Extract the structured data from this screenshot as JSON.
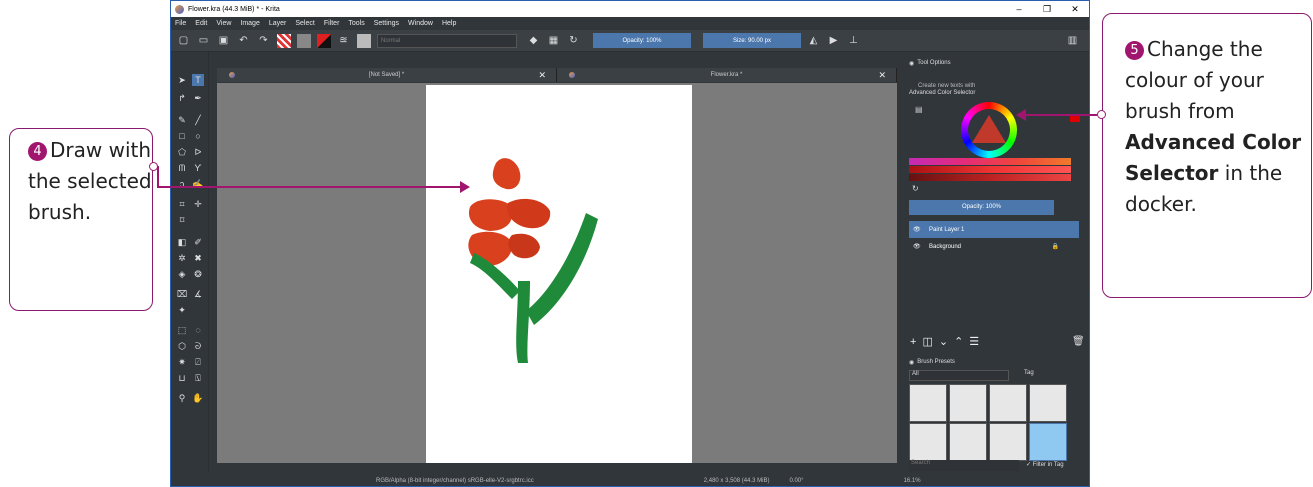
{
  "window": {
    "title": "Flower.kra (44.3 MiB)  * - Krita",
    "menu": [
      "File",
      "Edit",
      "View",
      "Image",
      "Layer",
      "Select",
      "Filter",
      "Tools",
      "Settings",
      "Window",
      "Help"
    ]
  },
  "toolbar": {
    "blend_mode": "Normal",
    "opacity": "Opacity: 100%",
    "size": "Size: 90.00 px"
  },
  "tabs": [
    {
      "label": "[Not Saved]  *"
    },
    {
      "label": "Flower.kra *"
    }
  ],
  "dockers": {
    "tool_options": "Tool Options",
    "tool_options_text": "Create new texts with",
    "color_selector": "Advanced Color Selector",
    "layers_opacity": "Opacity:  100%",
    "layers": [
      {
        "name": "Paint Layer 1",
        "selected": true
      },
      {
        "name": "Background",
        "selected": false
      }
    ],
    "brush_presets": "Brush Presets",
    "preset_filter": "All",
    "tag_label": "Tag",
    "search_placeholder": "Search",
    "filter_in_tag": "Filter in Tag"
  },
  "status": {
    "color_info": "RGB/Alpha (8-bit integer/channel)  sRGB-elle-V2-srgbtrc.icc",
    "dimensions": "2,480 x 3,508 (44.3 MiB)",
    "rotation": "0.00°",
    "zoom": "16.1%"
  },
  "callouts": {
    "step4": {
      "number": "4",
      "text": "Draw with the selected brush."
    },
    "step5": {
      "number": "5",
      "text_pre": "Change the colour of your brush from",
      "bold": "Advanced Color Selector",
      "text_post": "in the docker."
    }
  },
  "colors": {
    "accent": "#a0166f",
    "brush_red": "#d9411e",
    "brush_green": "#1f8a3a"
  }
}
